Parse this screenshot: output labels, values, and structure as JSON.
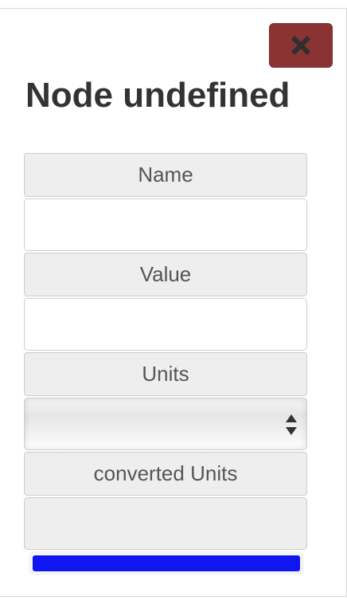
{
  "dialog": {
    "title": "Node undefined"
  },
  "close_button": {
    "icon": "close-icon",
    "color": "#8b3333"
  },
  "form": {
    "name": {
      "label": "Name",
      "value": "",
      "placeholder": ""
    },
    "value": {
      "label": "Value",
      "value": "",
      "placeholder": ""
    },
    "units": {
      "label": "Units",
      "selected": ""
    },
    "converted_units": {
      "label": "converted Units",
      "value": ""
    }
  },
  "progress": {
    "percent": 100,
    "color": "#0f16f2"
  }
}
